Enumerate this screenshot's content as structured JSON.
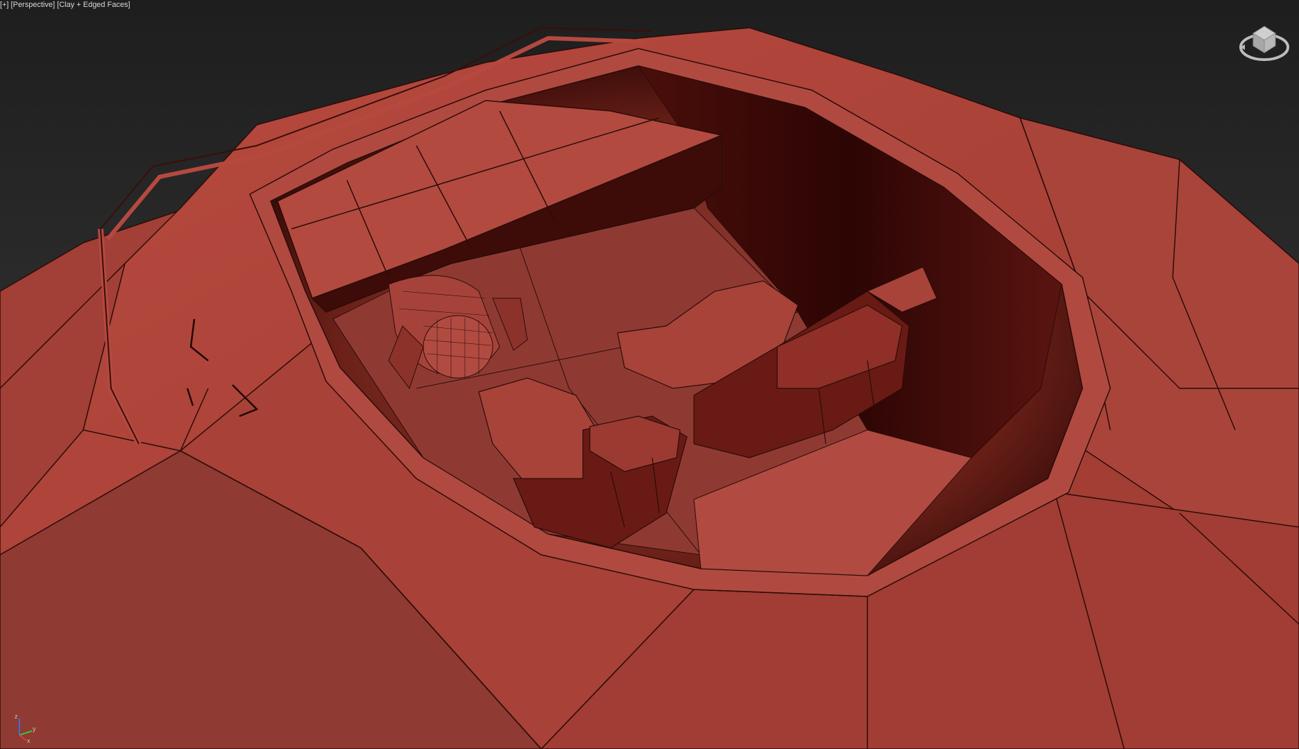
{
  "viewport": {
    "labels": {
      "plus": "[+]",
      "view": "[Perspective]",
      "shading": "[Clay + Edged Faces]"
    },
    "viewcube_icon": "viewcube-icon",
    "axis_icon": "axis-tripod-icon",
    "axis_labels": {
      "x": "x",
      "y": "y",
      "z": "z"
    },
    "colors": {
      "clay": "#b0463c",
      "clay_dark": "#6e1c16",
      "interior": "#3a0a08",
      "edges": "#2a0c08",
      "background": "#2b2b2b"
    }
  }
}
